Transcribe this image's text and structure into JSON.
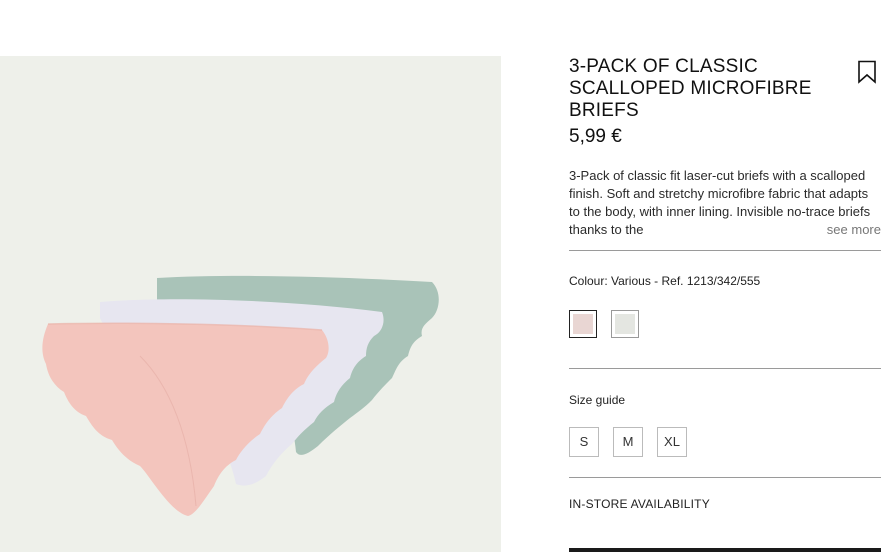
{
  "product": {
    "title": "3-PACK OF CLASSIC SCALLOPED MICROFIBRE BRIEFS",
    "price": "5,99 €",
    "description": "3-Pack of classic fit laser-cut briefs with a scalloped finish. Soft and stretchy microfibre fabric that adapts to the body, with inner lining. Invisible no-trace briefs thanks to the",
    "see_more": "see more",
    "bookmark_icon": "bookmark-icon"
  },
  "colour": {
    "label": "Colour: Various - Ref. 1213/342/555",
    "swatches": [
      {
        "name": "pink",
        "color": "#e9d6d3",
        "selected": true
      },
      {
        "name": "light-grey",
        "color": "#e4e6e1",
        "selected": false
      }
    ]
  },
  "size_guide": {
    "label": "Size guide"
  },
  "sizes": [
    "S",
    "M",
    "XL"
  ],
  "availability": {
    "label": "IN-STORE AVAILABILITY"
  },
  "image": {
    "background": "#eef0ea",
    "brief_colors": [
      "#a9c3b8",
      "#e6e6f0",
      "#f2c4bd"
    ]
  }
}
